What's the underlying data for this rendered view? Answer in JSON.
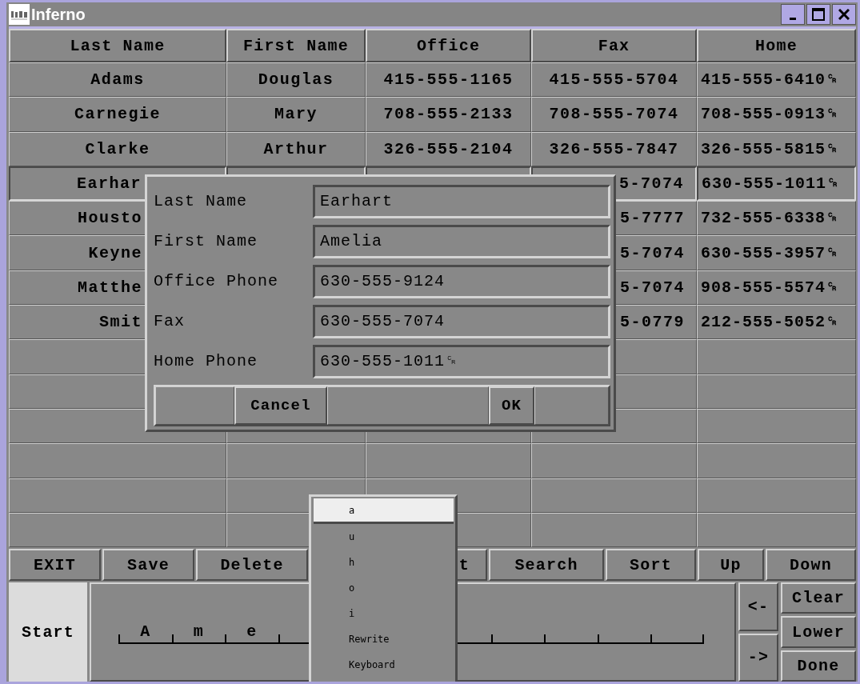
{
  "window": {
    "title": "Inferno"
  },
  "table": {
    "columns": [
      "Last Name",
      "First Name",
      "Office",
      "Fax",
      "Home"
    ],
    "rows": [
      {
        "kind": "full",
        "selected": false,
        "cells": [
          "Adams",
          "Douglas",
          "415-555-1165",
          "415-555-5704",
          "415-555-6410␍"
        ]
      },
      {
        "kind": "full",
        "selected": false,
        "cells": [
          "Carnegie",
          "Mary",
          "708-555-2133",
          "708-555-7074",
          "708-555-0913␍"
        ]
      },
      {
        "kind": "full",
        "selected": false,
        "cells": [
          "Clarke",
          "Arthur",
          "326-555-2104",
          "326-555-7847",
          "326-555-5815␍"
        ]
      },
      {
        "kind": "covered",
        "selected": true,
        "cells": [
          "Earhar",
          "5-7074",
          "630-555-1011␍"
        ]
      },
      {
        "kind": "covered",
        "selected": false,
        "cells": [
          "Housto",
          "5-7777",
          "732-555-6338␍"
        ]
      },
      {
        "kind": "covered",
        "selected": false,
        "cells": [
          "Keyne",
          "5-7074",
          "630-555-3957␍"
        ]
      },
      {
        "kind": "covered",
        "selected": false,
        "cells": [
          "Matthe",
          "5-7074",
          "908-555-5574␍"
        ]
      },
      {
        "kind": "covered",
        "selected": false,
        "cells": [
          "Smit",
          "5-0779",
          "212-555-5052␍"
        ]
      }
    ]
  },
  "dialog": {
    "fields": [
      {
        "label": "Last Name",
        "value": "Earhart"
      },
      {
        "label": "First Name",
        "value": "Amelia"
      },
      {
        "label": "Office Phone",
        "value": "630-555-9124"
      },
      {
        "label": "Fax",
        "value": "630-555-7074"
      },
      {
        "label": "Home Phone",
        "value": "630-555-1011␍"
      }
    ],
    "buttons": [
      "Cancel",
      "OK"
    ]
  },
  "button_bar": [
    {
      "label": "EXIT",
      "kind": "full"
    },
    {
      "label": "Save",
      "kind": "full"
    },
    {
      "label": "Delete",
      "kind": "full"
    },
    {
      "label": "t",
      "kind": "covered"
    },
    {
      "label": "Search",
      "kind": "full"
    },
    {
      "label": "Sort",
      "kind": "full"
    },
    {
      "label": "Up",
      "kind": "full"
    },
    {
      "label": "Down",
      "kind": "full"
    }
  ],
  "popup_menu": {
    "items": [
      {
        "label": "a",
        "selected": true
      },
      {
        "label": "u",
        "selected": false
      },
      {
        "label": "h",
        "selected": false
      },
      {
        "label": "o",
        "selected": false
      },
      {
        "label": "i",
        "selected": false
      },
      {
        "label": "Rewrite",
        "selected": false
      },
      {
        "label": "Keyboard",
        "selected": false
      }
    ]
  },
  "handwriting": {
    "start": "Start",
    "letters": [
      "A",
      "m",
      "e"
    ],
    "arrows": [
      "<-",
      "->"
    ],
    "buttons": [
      "Clear",
      "Lower",
      "Done"
    ]
  }
}
